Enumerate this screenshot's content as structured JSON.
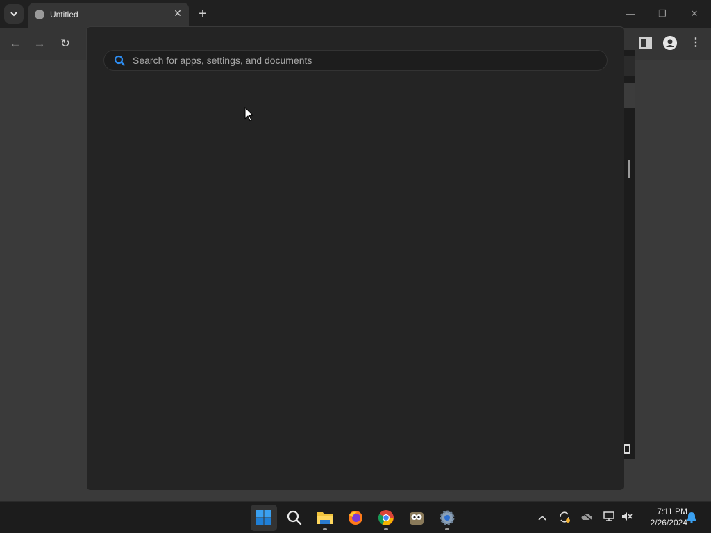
{
  "browser": {
    "tab": {
      "title": "Untitled"
    },
    "new_tab_label": "+",
    "window_controls": {
      "minimize": "—",
      "maximize": "❐",
      "close": "✕"
    },
    "nav": {
      "back": "←",
      "forward": "→",
      "reload": "↻"
    },
    "menu_glyph": "⋮"
  },
  "search": {
    "placeholder": "Search for apps, settings, and documents",
    "value": ""
  },
  "taskbar": {
    "apps": [
      {
        "name": "Start",
        "icon": "windows-logo-icon"
      },
      {
        "name": "Search",
        "icon": "search-icon"
      },
      {
        "name": "File Explorer",
        "icon": "folder-icon"
      },
      {
        "name": "Firefox",
        "icon": "firefox-icon"
      },
      {
        "name": "Chrome",
        "icon": "chrome-icon"
      },
      {
        "name": "GIMP",
        "icon": "gimp-icon"
      },
      {
        "name": "Settings",
        "icon": "gear-icon"
      }
    ],
    "tray": {
      "chevron": "^",
      "time": "7:11 PM",
      "date": "2/26/2024"
    }
  },
  "colors": {
    "accent": "#0078d4",
    "panel": "#242424",
    "taskbar": "#1c1c1c"
  }
}
